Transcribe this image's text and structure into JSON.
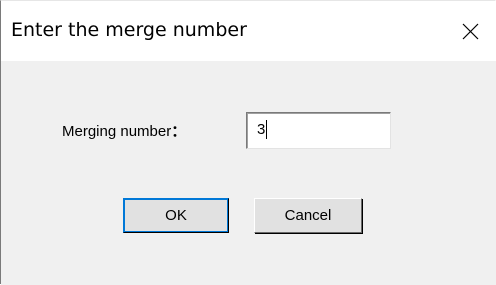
{
  "dialog": {
    "title": "Enter the merge number",
    "close_icon": "close-icon"
  },
  "form": {
    "label_text": "Merging number",
    "label_colon": "：",
    "value": "3"
  },
  "buttons": {
    "ok_label": "OK",
    "cancel_label": "Cancel"
  }
}
